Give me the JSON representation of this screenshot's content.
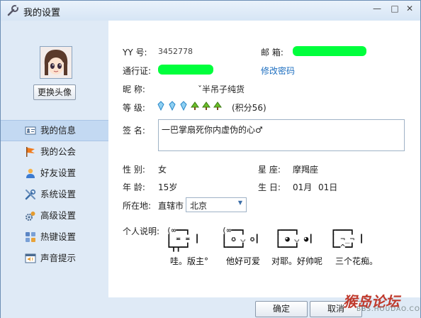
{
  "window": {
    "title": "我的设置",
    "minimize": "—",
    "maximize": "□",
    "close": "✕"
  },
  "sidebar": {
    "change_avatar": "更换头像",
    "items": [
      {
        "label": "我的信息",
        "icon": "id-card-icon"
      },
      {
        "label": "我的公会",
        "icon": "flag-icon"
      },
      {
        "label": "好友设置",
        "icon": "friend-icon"
      },
      {
        "label": "系统设置",
        "icon": "tools-icon"
      },
      {
        "label": "高级设置",
        "icon": "advanced-gear-icon"
      },
      {
        "label": "热键设置",
        "icon": "hotkey-icon"
      },
      {
        "label": "声音提示",
        "icon": "sound-icon"
      }
    ]
  },
  "profile": {
    "yy_label": "YY 号:",
    "yy_value": "3452778",
    "email_label": "邮  箱:",
    "passport_label": "通行证:",
    "change_password": "修改密码",
    "nickname_label": "昵  称:",
    "nickname_value": "ˇ半吊子纯货",
    "level_label": "等  级:",
    "level_points": "(积分56)",
    "signature_label": "签  名:",
    "signature_value": "一巴掌扇死你内虚伪的心♂",
    "gender_label": "性  别:",
    "gender_value": "女",
    "zodiac_label": "星  座:",
    "zodiac_value": "摩羯座",
    "age_label": "年  龄:",
    "age_value": "15岁",
    "birthday_label": "生  日:",
    "birthday_month": "01月",
    "birthday_day": "01日",
    "location_label": "所在地:",
    "location_region": "直辖市",
    "location_city": "北京",
    "intro_label": "个人说明:",
    "intro_items": [
      {
        "art": "(∞━━┓\n┃ ≖ ≖ ┃\n┗┳┳━┛",
        "caption": "哇。版主°"
      },
      {
        "art": "(∞━━┓\n┃ ✪ ◡ ✪┃\n┗━━━┛",
        "caption": "他好可爱"
      },
      {
        "art": "┏━━━┓\n┃ ◕ ◡ ◕┃\n┗━━━┛",
        "caption": "对耶。好帅呢"
      },
      {
        "art": "┏━━━┓\n┃ ¬_¬ ┃\n┗━^━┛",
        "caption": "三个花痴。"
      }
    ]
  },
  "footer": {
    "ok": "确定",
    "cancel": "取消"
  },
  "watermark": {
    "main": "猴岛论坛",
    "sub": "BBS.HOUDAO.COM"
  },
  "colors": {
    "accent": "#1e6fc0",
    "highlight_green": "#00ff3c",
    "panel_bg": "#dfeaf6"
  }
}
